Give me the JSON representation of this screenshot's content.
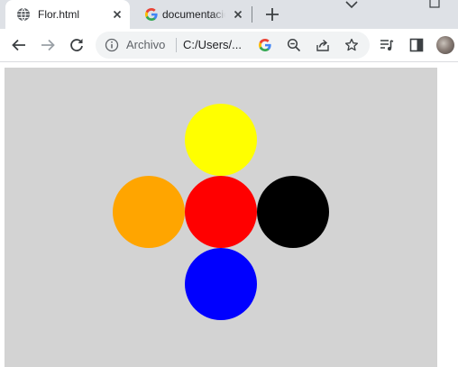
{
  "tabs": [
    {
      "title": "Flor.html",
      "active": true,
      "favicon": "globe-icon"
    },
    {
      "title": "documentación",
      "active": false,
      "favicon": "google-g-icon"
    }
  ],
  "toolbar": {
    "omnibox": {
      "security_label": "Archivo",
      "url": "C:/Users/..."
    }
  },
  "page": {
    "background": "#d3d3d3",
    "circles": [
      {
        "name": "yellow-circle",
        "color": "#ffff00"
      },
      {
        "name": "orange-circle",
        "color": "#ffa500"
      },
      {
        "name": "red-circle",
        "color": "#ff0000"
      },
      {
        "name": "black-circle",
        "color": "#000000"
      },
      {
        "name": "blue-circle",
        "color": "#0000ff"
      }
    ]
  }
}
